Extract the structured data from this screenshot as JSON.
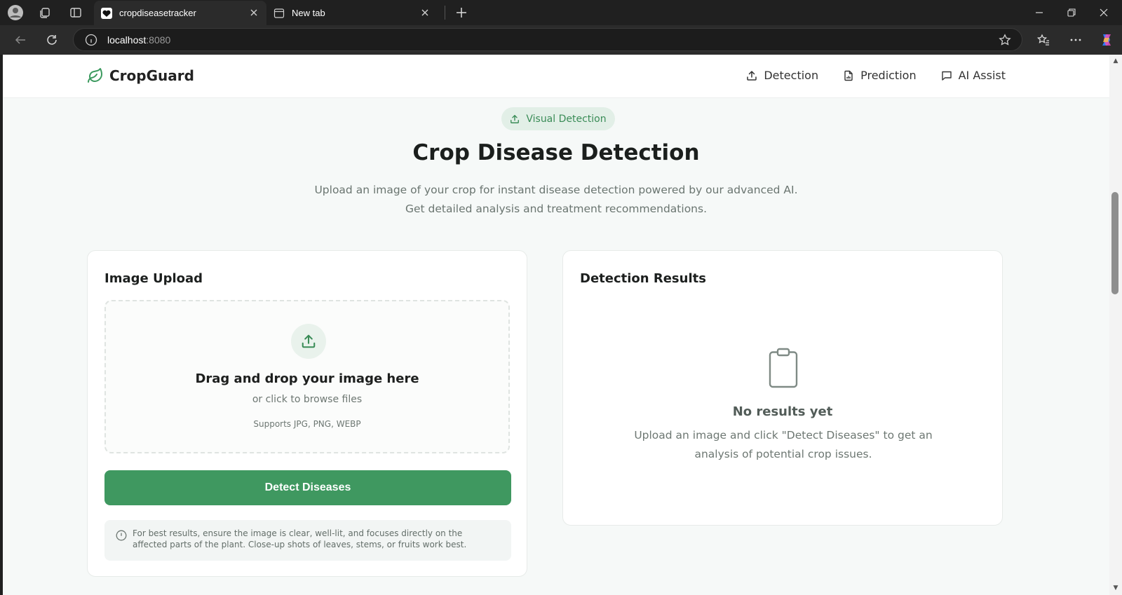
{
  "browser": {
    "tabs": [
      {
        "title": "cropdiseasetracker",
        "active": true
      },
      {
        "title": "New tab",
        "active": false
      }
    ],
    "url_host": "localhost",
    "url_port": ":8080"
  },
  "header": {
    "brand": "CropGuard",
    "nav": [
      {
        "label": "Detection",
        "icon": "upload-icon"
      },
      {
        "label": "Prediction",
        "icon": "file-chart-icon"
      },
      {
        "label": "AI Assist",
        "icon": "chat-icon"
      }
    ]
  },
  "hero": {
    "badge": "Visual Detection",
    "title": "Crop Disease Detection",
    "subtitle": "Upload an image of your crop for instant disease detection powered by our advanced AI. Get detailed analysis and treatment recommendations."
  },
  "upload_card": {
    "title": "Image Upload",
    "drop_title": "Drag and drop your image here",
    "drop_sub": "or click to browse files",
    "drop_note": "Supports JPG, PNG, WEBP",
    "button": "Detect Diseases",
    "tip": "For best results, ensure the image is clear, well-lit, and focuses directly on the affected parts of the plant. Close-up shots of leaves, stems, or fruits work best."
  },
  "results_card": {
    "title": "Detection Results",
    "empty_title": "No results yet",
    "empty_sub": "Upload an image and click \"Detect Diseases\" to get an analysis of potential crop issues."
  },
  "colors": {
    "accent": "#3f9860",
    "background": "#f6f9f8"
  }
}
